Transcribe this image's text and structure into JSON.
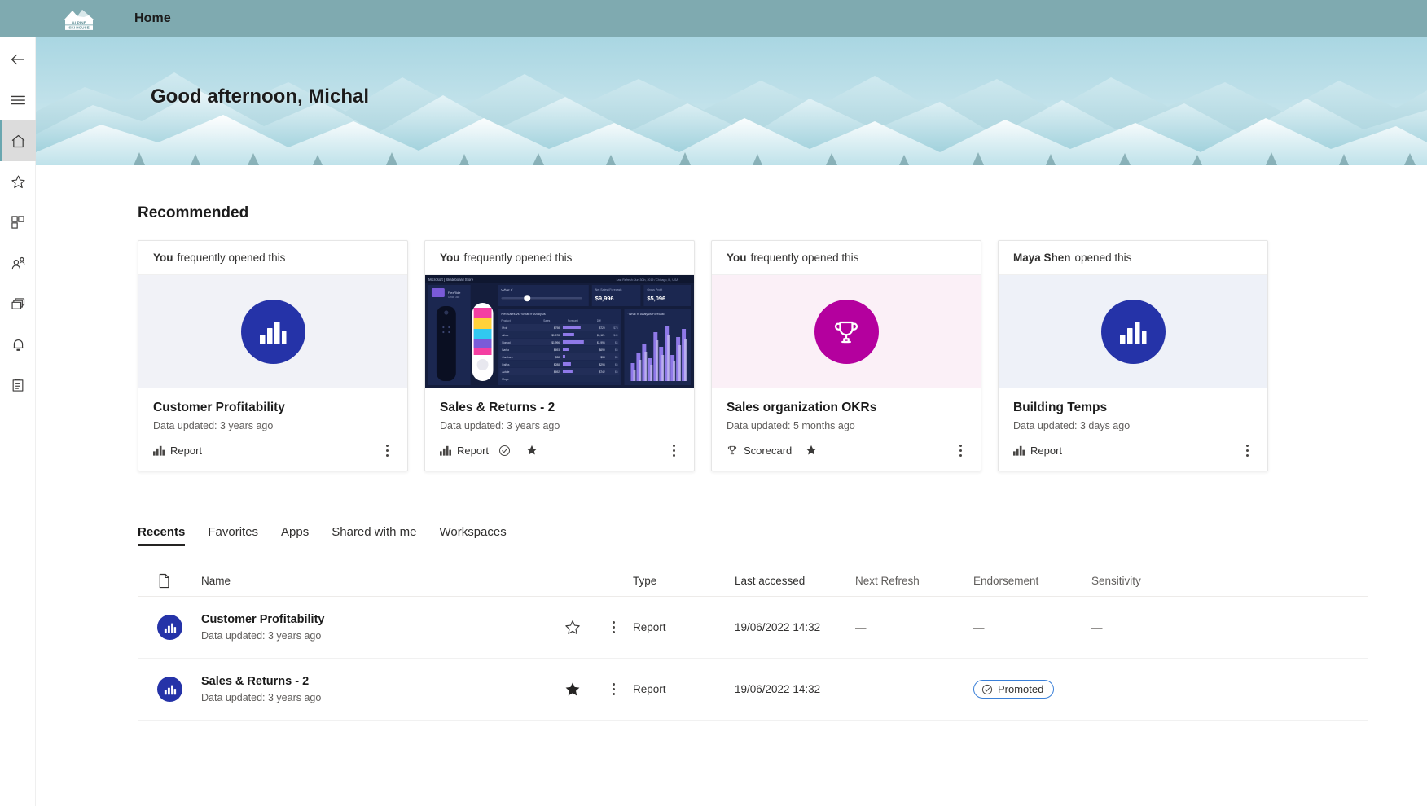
{
  "topbar": {
    "brand_line1": "ALPINE",
    "brand_line2": "SKI HOUSE",
    "title": "Home",
    "bg": "#7FAAB0"
  },
  "rail": {
    "items": [
      {
        "name": "back-arrow-icon",
        "label": "Back",
        "active": false
      },
      {
        "name": "hamburger-menu-icon",
        "label": "Navigation menu",
        "active": false
      },
      {
        "name": "home-icon",
        "label": "Home",
        "active": true
      },
      {
        "name": "star-icon",
        "label": "Favorites",
        "active": false
      },
      {
        "name": "apps-grid-icon",
        "label": "Apps",
        "active": false
      },
      {
        "name": "shared-with-me-icon",
        "label": "Shared with me",
        "active": false
      },
      {
        "name": "workspaces-icon",
        "label": "Workspaces",
        "active": false
      },
      {
        "name": "bell-icon",
        "label": "Notifications",
        "active": false
      },
      {
        "name": "clipboard-icon",
        "label": "Metrics",
        "active": false
      }
    ]
  },
  "hero": {
    "greeting": "Good afternoon, Michal"
  },
  "recommended": {
    "heading": "Recommended",
    "cards": [
      {
        "attribution_actor": "You",
        "attribution_text": "frequently opened this",
        "thumb_kind": "circle-bar-chart",
        "thumb_bg": "#f1f2f7",
        "circle_color": "#2533A8",
        "title": "Customer Profitability",
        "subtitle": "Data updated: 3 years ago",
        "type_icon": "bar-chart-icon",
        "type_label": "Report",
        "certified": false,
        "favorite": false
      },
      {
        "attribution_actor": "You",
        "attribution_text": "frequently opened this",
        "thumb_kind": "report-preview",
        "thumb_bg": "#16213f",
        "circle_color": "#2533A8",
        "title": "Sales & Returns  - 2",
        "subtitle": "Data updated: 3 years ago",
        "type_icon": "bar-chart-icon",
        "type_label": "Report",
        "certified": true,
        "favorite": true
      },
      {
        "attribution_actor": "You",
        "attribution_text": "frequently opened this",
        "thumb_kind": "circle-trophy",
        "thumb_bg": "#fbf0f7",
        "circle_color": "#B4009E",
        "title": "Sales organization OKRs",
        "subtitle": "Data updated: 5 months ago",
        "type_icon": "trophy-icon",
        "type_label": "Scorecard",
        "certified": false,
        "favorite": true
      },
      {
        "attribution_actor": "Maya Shen",
        "attribution_text": "opened this",
        "thumb_kind": "circle-bar-chart",
        "thumb_bg": "#eef1f8",
        "circle_color": "#2533A8",
        "title": "Building Temps",
        "subtitle": "Data updated: 3 days ago",
        "type_icon": "bar-chart-icon",
        "type_label": "Report",
        "certified": false,
        "favorite": false
      }
    ]
  },
  "tabs": [
    {
      "label": "Recents",
      "active": true
    },
    {
      "label": "Favorites",
      "active": false
    },
    {
      "label": "Apps",
      "active": false
    },
    {
      "label": "Shared with me",
      "active": false
    },
    {
      "label": "Workspaces",
      "active": false
    }
  ],
  "table": {
    "columns": [
      "",
      "Name",
      "",
      "",
      "Type",
      "Last accessed",
      "Next Refresh",
      "Endorsement",
      "Sensitivity"
    ],
    "headers": {
      "icon": "document-icon",
      "name": "Name",
      "type": "Type",
      "last_accessed": "Last accessed",
      "next_refresh": "Next Refresh",
      "endorsement": "Endorsement",
      "sensitivity": "Sensitivity"
    },
    "rows": [
      {
        "icon": "bar-chart-icon",
        "icon_color": "#2533A8",
        "name": "Customer Profitability",
        "subtitle": "Data updated: 3 years ago",
        "favorite": false,
        "type": "Report",
        "last_accessed": "19/06/2022 14:32",
        "next_refresh": "—",
        "endorsement": "—",
        "endorsement_badge": null,
        "sensitivity": "—"
      },
      {
        "icon": "bar-chart-icon",
        "icon_color": "#2533A8",
        "name": "Sales & Returns  - 2",
        "subtitle": "Data updated: 3 years ago",
        "favorite": true,
        "type": "Report",
        "last_accessed": "19/06/2022 14:32",
        "next_refresh": "—",
        "endorsement": "",
        "endorsement_badge": "Promoted",
        "sensitivity": "—"
      }
    ]
  },
  "colors": {
    "accent_teal": "#7FAAB0",
    "brand_blue": "#2533A8",
    "scorecard_magenta": "#B4009E",
    "promoted_border": "#3b80d8"
  }
}
